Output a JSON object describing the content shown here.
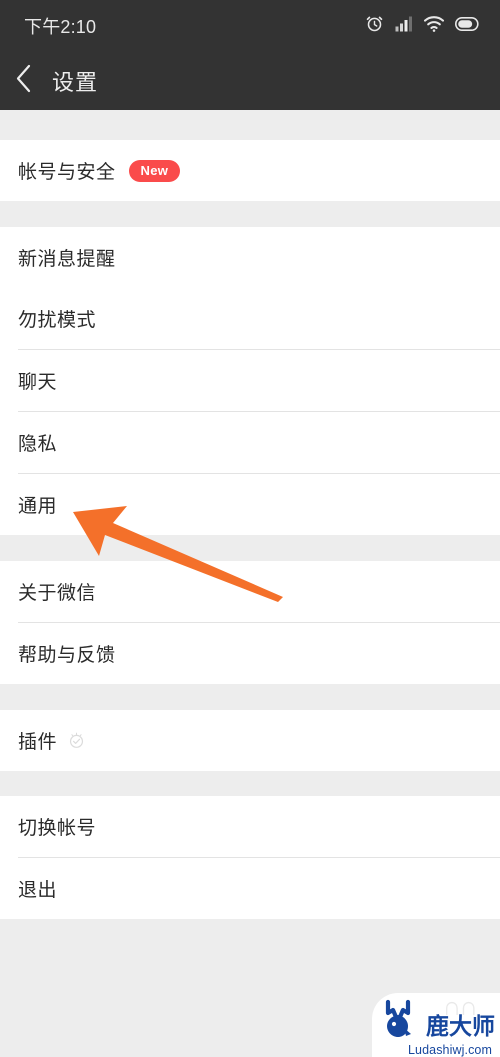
{
  "statusbar": {
    "time": "下午2:10",
    "icons": [
      "alarm-icon",
      "signal-icon",
      "wifi-icon",
      "battery-icon"
    ]
  },
  "navbar": {
    "back_icon": "chevron-left-icon",
    "title": "设置"
  },
  "colors": {
    "header_bg": "#333333",
    "page_bg": "#ededed",
    "row_bg": "#ffffff",
    "badge_red": "#fa4b4b",
    "arrow_orange": "#f4702a",
    "watermark_blue": "#17479e",
    "text": "#2b2b2b",
    "separator": "#e3e3e3"
  },
  "sections": [
    {
      "name": "account",
      "rows": [
        {
          "label": "帐号与安全",
          "badge": "New",
          "icon": null
        }
      ]
    },
    {
      "name": "preferences",
      "rows": [
        {
          "label": "新消息提醒",
          "badge": null,
          "icon": null
        },
        {
          "label": "勿扰模式",
          "badge": null,
          "icon": null
        },
        {
          "label": "聊天",
          "badge": null,
          "icon": null
        },
        {
          "label": "隐私",
          "badge": null,
          "icon": null
        },
        {
          "label": "通用",
          "badge": null,
          "icon": null
        }
      ]
    },
    {
      "name": "info",
      "rows": [
        {
          "label": "关于微信",
          "badge": null,
          "icon": null
        },
        {
          "label": "帮助与反馈",
          "badge": null,
          "icon": null
        }
      ]
    },
    {
      "name": "plugins",
      "rows": [
        {
          "label": "插件",
          "badge": null,
          "icon": "plugin-badge-icon"
        }
      ]
    },
    {
      "name": "account-actions",
      "rows": [
        {
          "label": "切换帐号",
          "badge": null,
          "icon": null
        },
        {
          "label": "退出",
          "badge": null,
          "icon": null
        }
      ]
    }
  ],
  "annotation": {
    "type": "arrow",
    "points_to": "通用",
    "color": "#f4702a"
  },
  "watermark": {
    "brand_cn": "鹿大师",
    "url": "Ludashiwj.com",
    "logo": "deer-logo-icon"
  }
}
